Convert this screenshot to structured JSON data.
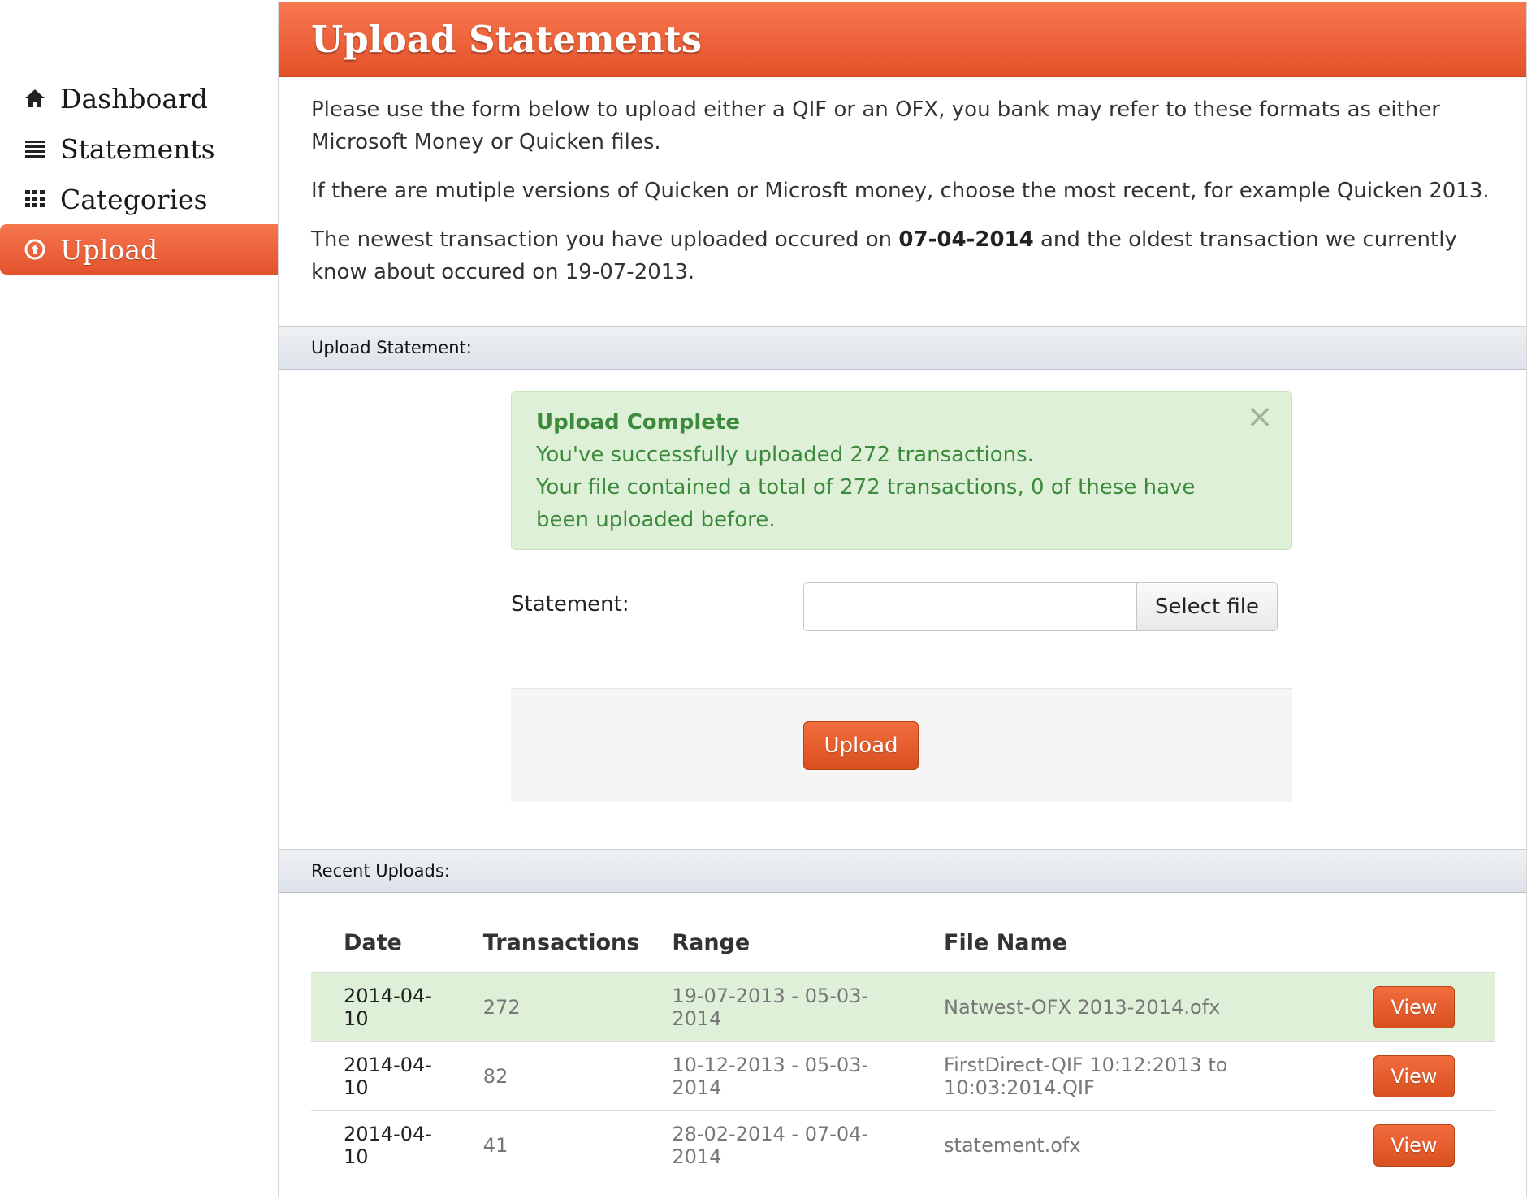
{
  "sidebar": {
    "items": [
      {
        "label": "Dashboard",
        "icon": "home-icon"
      },
      {
        "label": "Statements",
        "icon": "list-icon"
      },
      {
        "label": "Categories",
        "icon": "grid-icon"
      },
      {
        "label": "Upload",
        "icon": "upload-circle-icon",
        "active": true
      }
    ]
  },
  "page": {
    "title": "Upload Statements",
    "intro_1": "Please use the form below to upload either a QIF or an OFX, you bank may refer to these formats as either Microsoft Money or Quicken files.",
    "intro_2": "If there are mutiple versions of Quicken or Microsft money, choose the most recent, for example Quicken 2013.",
    "intro_3_a": "The newest transaction you have uploaded occured on ",
    "intro_3_date": "07-04-2014",
    "intro_3_b": " and the oldest transaction we currently know about occured on 19-07-2013."
  },
  "upload_section": {
    "heading": "Upload Statement:",
    "alert": {
      "title": "Upload Complete",
      "line1": "You've successfully uploaded 272 transactions.",
      "line2": "Your file contained a total of 272 transactions, 0 of these have been uploaded before."
    },
    "statement_label": "Statement:",
    "file_value": "",
    "select_file_label": "Select file",
    "upload_label": "Upload"
  },
  "recent_section": {
    "heading": "Recent Uploads:",
    "columns": [
      "Date",
      "Transactions",
      "Range",
      "File Name"
    ],
    "rows": [
      {
        "date": "2014-04-10",
        "transactions": "272",
        "range": "19-07-2013 - 05-03-2014",
        "file": "Natwest-OFX 2013-2014.ofx",
        "action": "View",
        "highlight": true
      },
      {
        "date": "2014-04-10",
        "transactions": "82",
        "range": "10-12-2013 - 05-03-2014",
        "file": "FirstDirect-QIF 10:12:2013 to 10:03:2014.QIF",
        "action": "View"
      },
      {
        "date": "2014-04-10",
        "transactions": "41",
        "range": "28-02-2014 - 07-04-2014",
        "file": "statement.ofx",
        "action": "View"
      }
    ]
  },
  "colors": {
    "accent": "#e4512a",
    "success_bg": "#dff0d8",
    "success_text": "#3c8a3c"
  }
}
